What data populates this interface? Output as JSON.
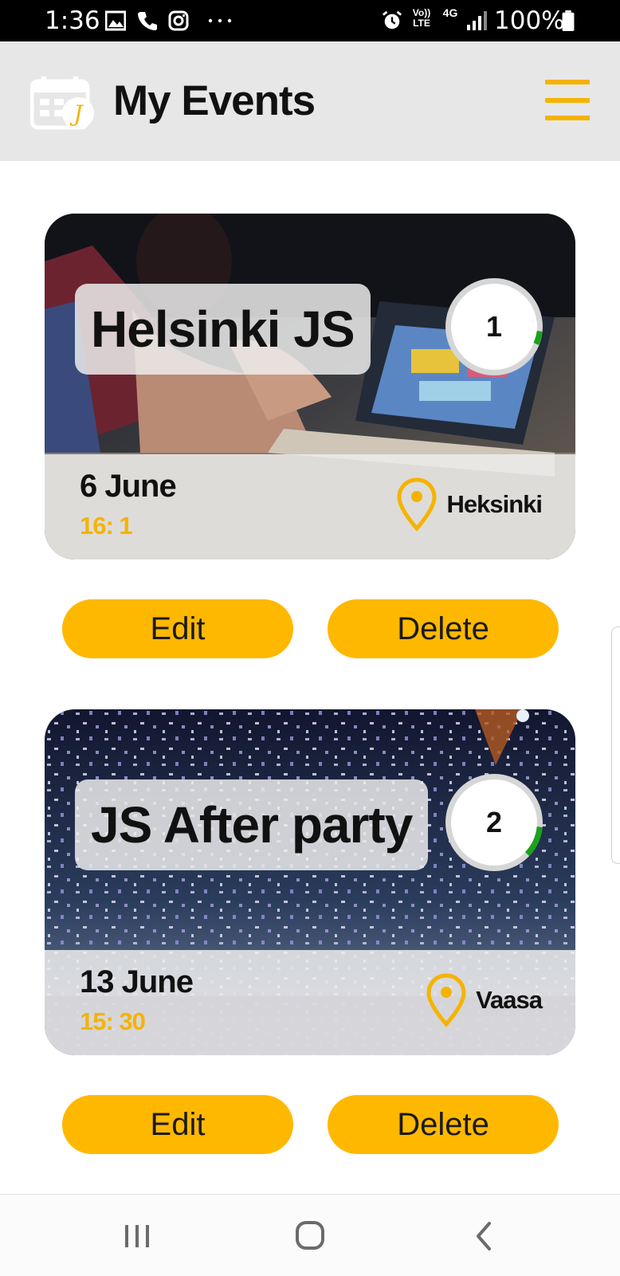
{
  "status_bar": {
    "time": "1:36",
    "battery_percent": "100%",
    "volte": "Vo)) LTE",
    "network": "4G",
    "icons": [
      "gallery-icon",
      "phone-icon",
      "instagram-icon",
      "more-icon",
      "alarm-icon",
      "signal-icon",
      "battery-icon"
    ]
  },
  "header": {
    "title": "My Events",
    "logo_icon": "calendar-js-logo-icon",
    "menu_icon": "hamburger-menu-icon"
  },
  "events": [
    {
      "title": "Helsinki JS",
      "count": "1",
      "progress": 0.05,
      "date": "6 June",
      "time": "16: 1",
      "location": "Heksinki",
      "image": "photo of people at laptops",
      "edit_label": "Edit",
      "delete_label": "Delete"
    },
    {
      "title": "JS After party",
      "count": "2",
      "progress": 0.1,
      "date": "13 June",
      "time": "15: 30",
      "location": "Vaasa",
      "image": "photo of confetti at concert",
      "edit_label": "Edit",
      "delete_label": "Delete"
    }
  ],
  "colors": {
    "accent": "#f5b301",
    "button": "#ffb800",
    "progress": "#1aa21a",
    "header_bg": "#e7e7e7"
  },
  "nav": {
    "icons": [
      "recent-apps-icon",
      "home-icon",
      "back-icon"
    ]
  }
}
